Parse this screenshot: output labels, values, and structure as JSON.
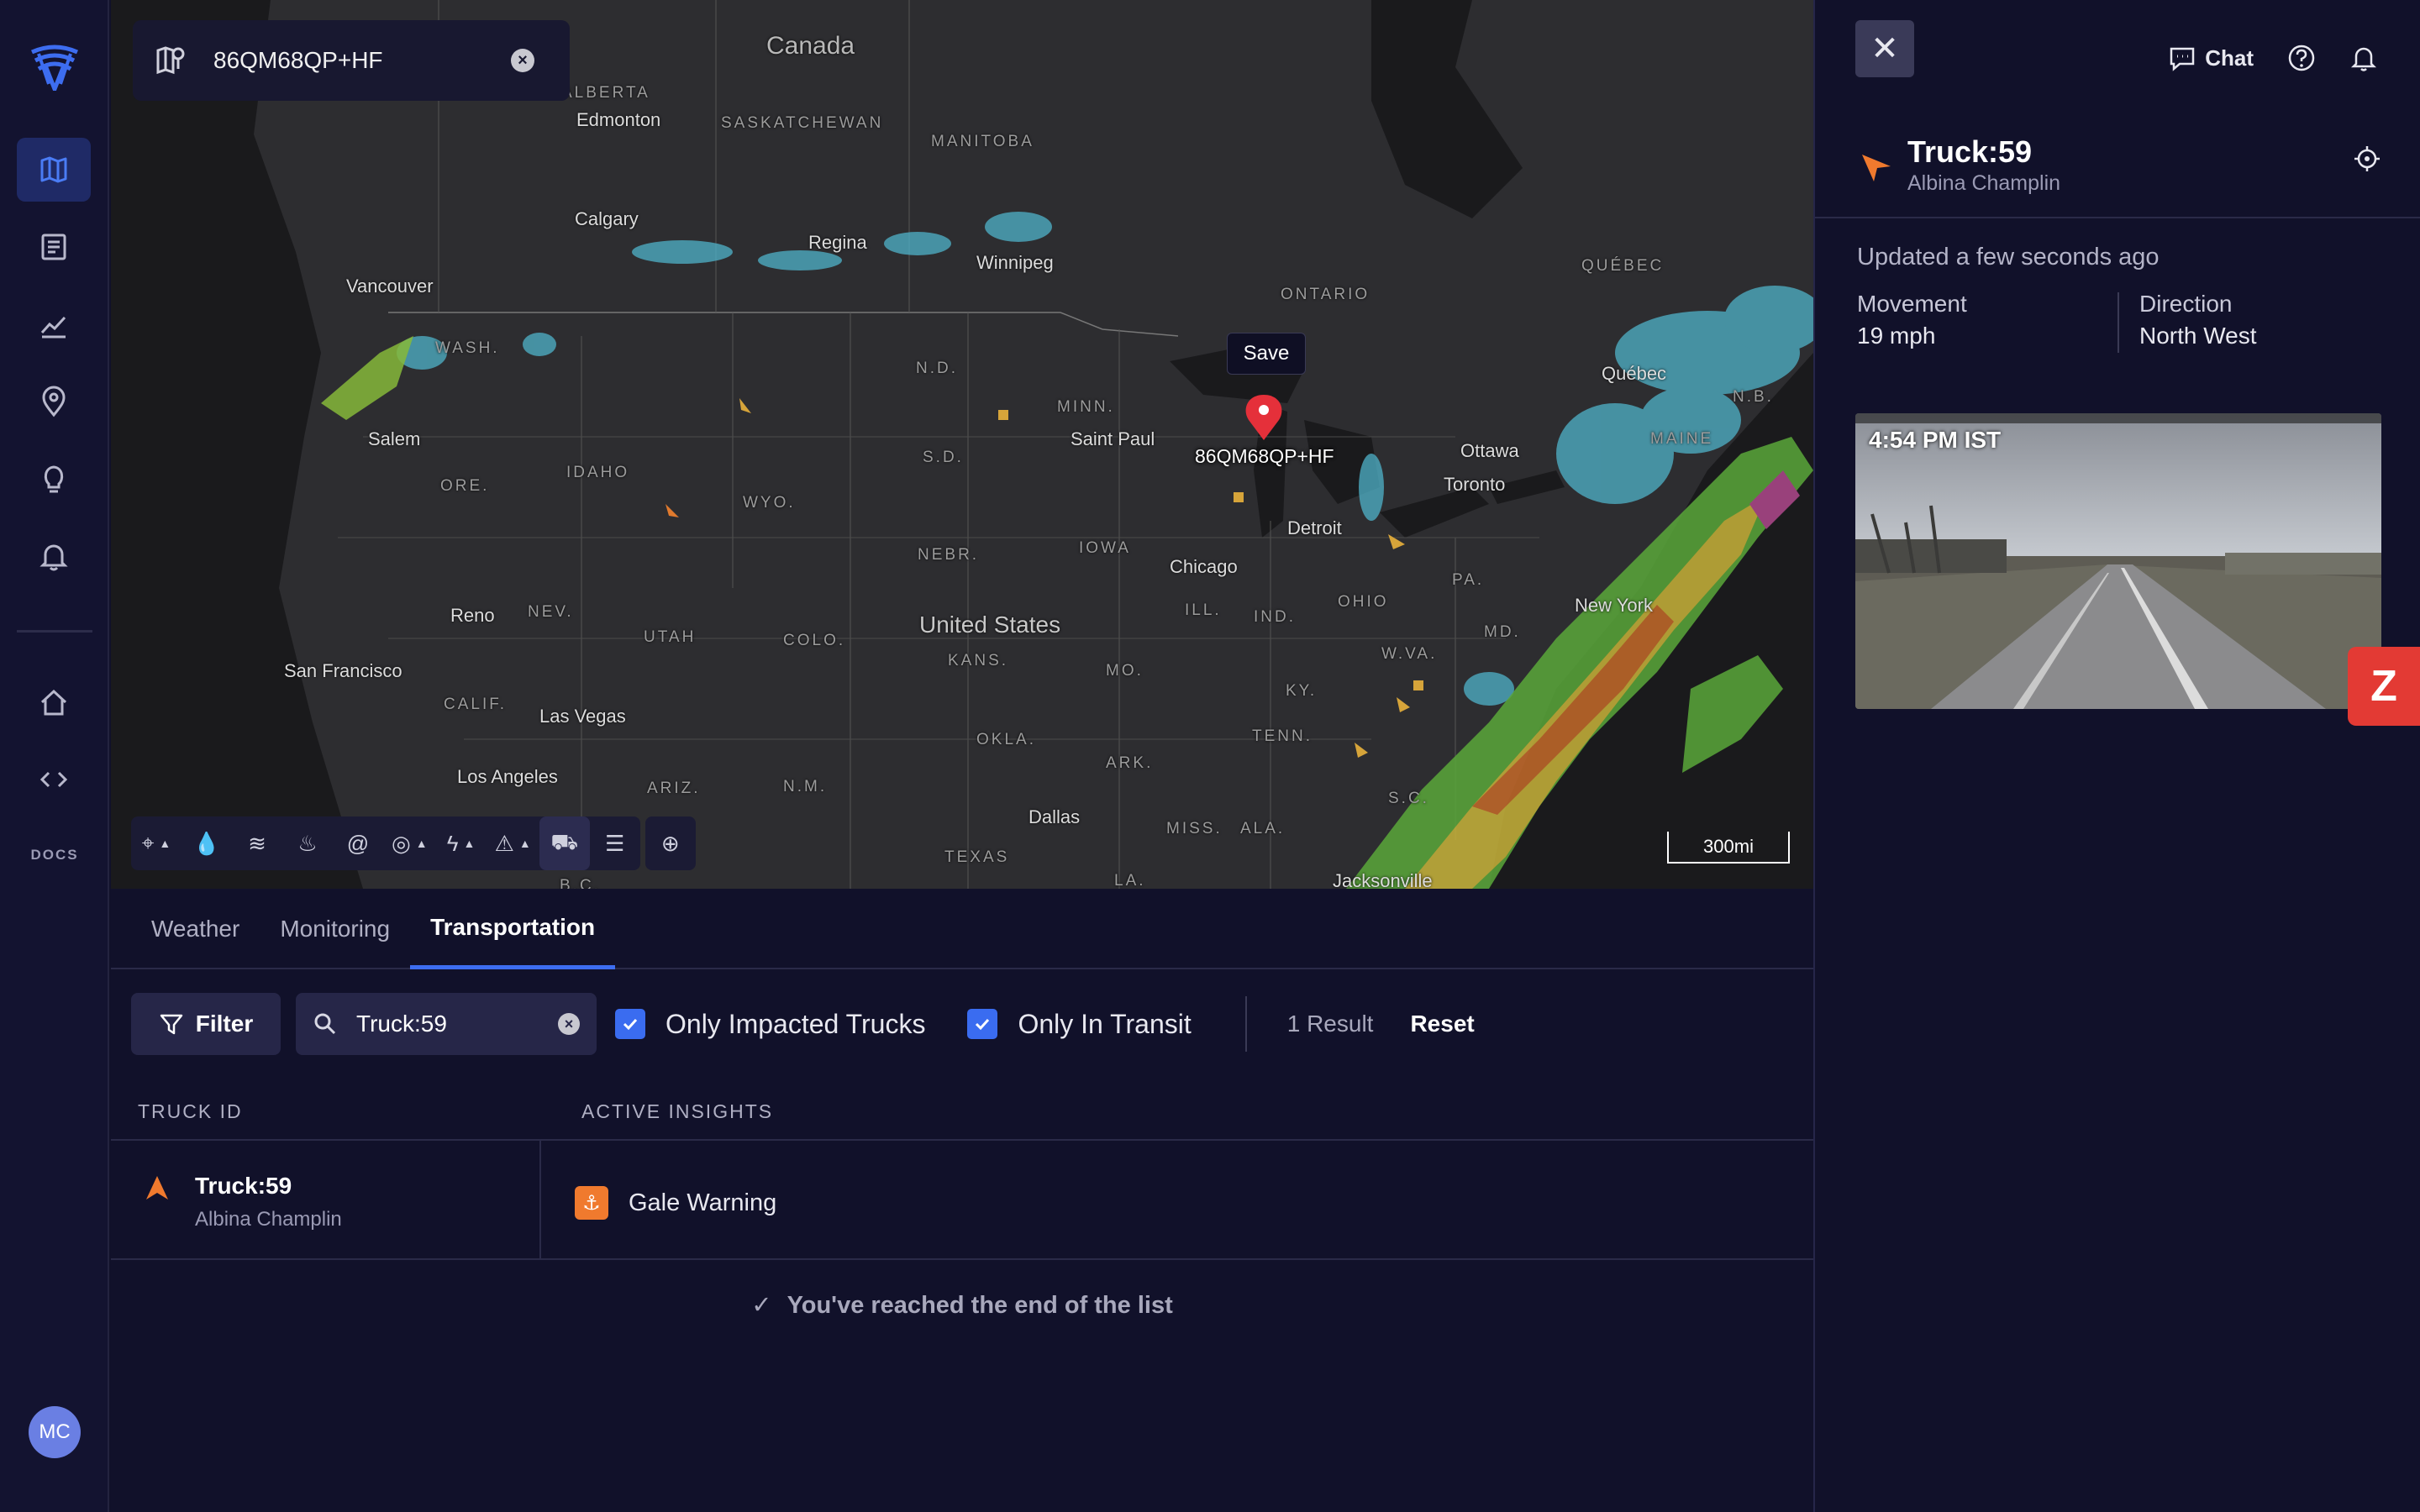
{
  "nav": {
    "items": [
      "map-icon",
      "report-icon",
      "chart-icon",
      "location-icon",
      "lightbulb-icon",
      "bell-icon",
      "home-icon",
      "code-icon"
    ],
    "docs_label": "DOCS",
    "avatar_initials": "MC"
  },
  "map": {
    "search_value": "86QM68QP+HF",
    "save_tooltip": "Save",
    "pin_label": "86QM68QP+HF",
    "scale_label": "300mi",
    "labels": {
      "canada": "Canada",
      "united_states": "United States",
      "alberta": "ALBERTA",
      "saskatchewan": "SASKATCHEWAN",
      "manitoba": "MANITOBA",
      "ontario": "ONTARIO",
      "quebec": "QUÉBEC",
      "quebec_city": "Québec",
      "edmonton": "Edmonton",
      "calgary": "Calgary",
      "regina": "Regina",
      "winnipeg": "Winnipeg",
      "vancouver": "Vancouver",
      "wash": "WASH.",
      "salem": "Salem",
      "ore": "ORE.",
      "idaho": "IDAHO",
      "wyo": "WYO.",
      "nd": "N.D.",
      "minn": "MINN.",
      "sd": "S.D.",
      "saint_paul": "Saint Paul",
      "nebr": "NEBR.",
      "iowa": "IOWA",
      "chicago": "Chicago",
      "detroit": "Detroit",
      "toronto": "Toronto",
      "ottawa": "Ottawa",
      "maine": "MAINE",
      "nb": "N.B.",
      "ohio": "OHIO",
      "ill": "ILL.",
      "ind": "IND.",
      "pa": "PA.",
      "md": "MD.",
      "new_york": "New York",
      "wva": "W.VA.",
      "ky": "KY.",
      "tenn": "TENN.",
      "sc": "S.C.",
      "reno": "Reno",
      "nev": "NEV.",
      "utah": "UTAH",
      "colo": "COLO.",
      "kans": "KANS.",
      "mo": "MO.",
      "san_francisco": "San Francisco",
      "calif": "CALIF.",
      "las_vegas": "Las Vegas",
      "los_angeles": "Los Angeles",
      "ariz": "ARIZ.",
      "nm": "N.M.",
      "okla": "OKLA.",
      "ark": "ARK.",
      "dallas": "Dallas",
      "texas": "TEXAS",
      "miss": "MISS.",
      "ala": "ALA.",
      "la": "LA.",
      "jacksonville": "Jacksonville",
      "bc": "B.C."
    }
  },
  "tabs": [
    "Weather",
    "Monitoring",
    "Transportation"
  ],
  "filters": {
    "filter_label": "Filter",
    "search_value": "Truck:59",
    "only_impacted": "Only Impacted Trucks",
    "only_transit": "Only In Transit",
    "result_count": "1 Result",
    "reset_label": "Reset"
  },
  "table": {
    "headers": [
      "TRUCK ID",
      "ACTIVE INSIGHTS"
    ],
    "rows": [
      {
        "truck_id": "Truck:59",
        "driver": "Albina Champlin",
        "insight": "Gale Warning"
      }
    ],
    "end_message": "You've reached the end of the list"
  },
  "detail": {
    "chat_label": "Chat",
    "truck_id": "Truck:59",
    "driver": "Albina Champlin",
    "updated": "Updated a few seconds ago",
    "movement_label": "Movement",
    "movement_value": "19 mph",
    "direction_label": "Direction",
    "direction_value": "North West",
    "camera_time": "4:54 PM IST"
  },
  "colors": {
    "accent": "#3d6df0",
    "truck_orange": "#f07a2e",
    "pin_red": "#e5303a",
    "badge_red": "#e33a34"
  }
}
